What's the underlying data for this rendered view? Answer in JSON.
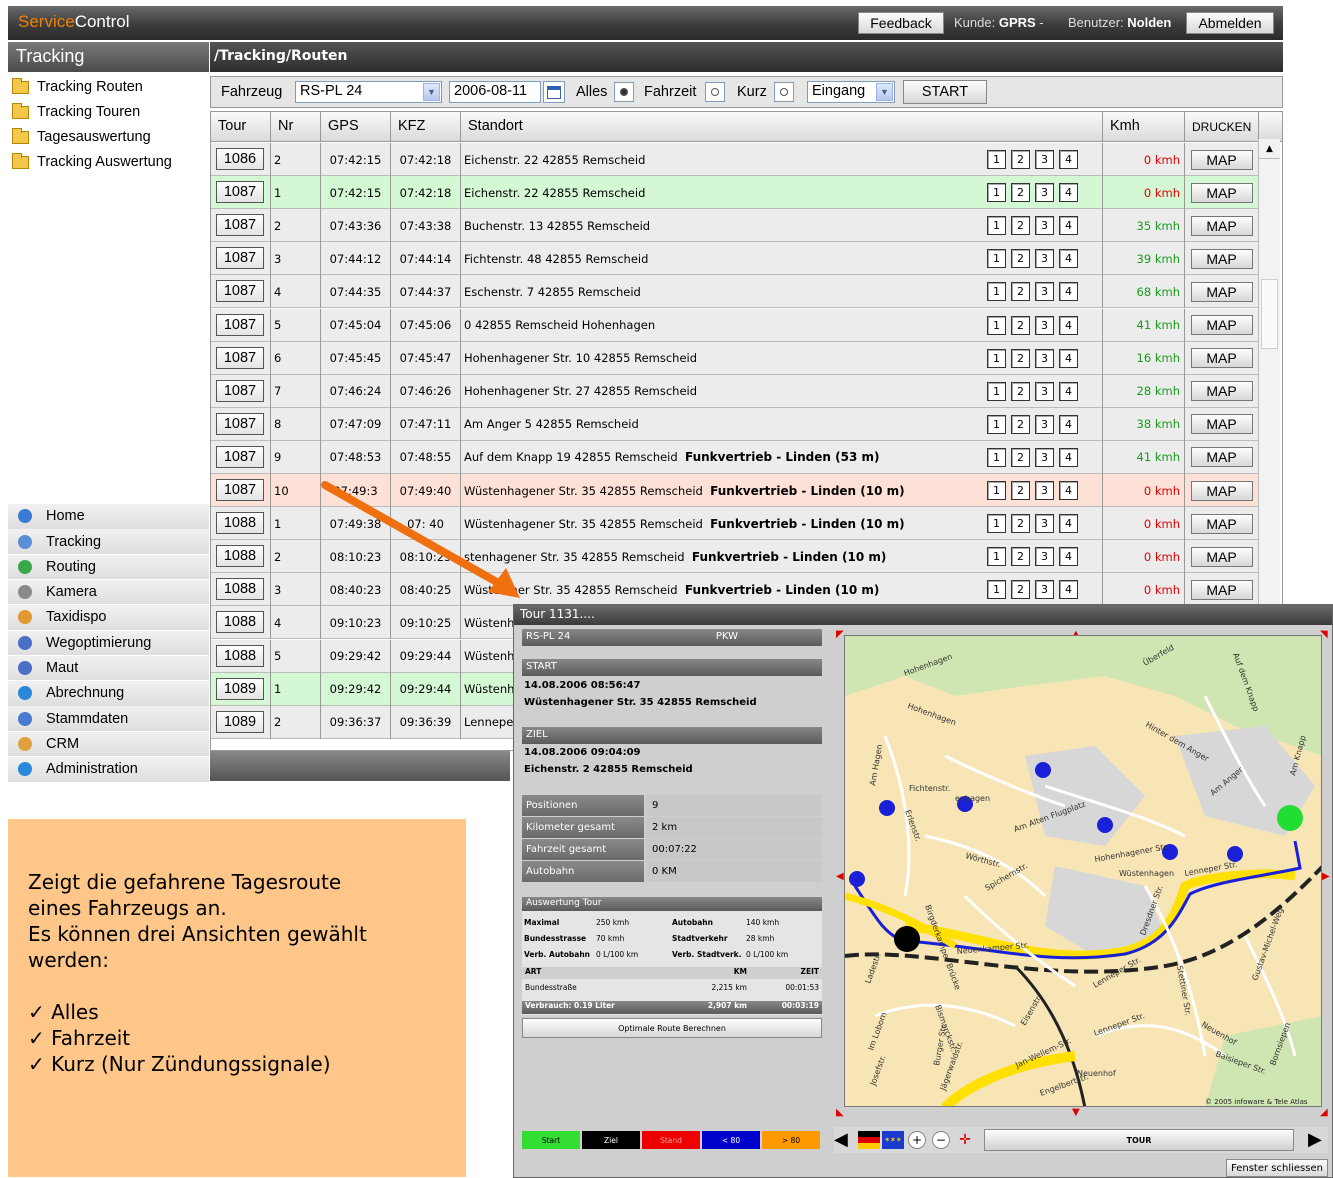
{
  "topbar": {
    "brand_prefix": "Service",
    "brand_suffix": "Control",
    "feedback_label": "Feedback",
    "customer_label": "Kunde:",
    "customer_value": "GPRS",
    "separator": "-",
    "user_label": "Benutzer:",
    "user_value": "Nolden",
    "logout_label": "Abmelden"
  },
  "sidebar": {
    "title": "Tracking",
    "tree": [
      "Tracking Routen",
      "Tracking Touren",
      "Tagesauswertung",
      "Tracking Auswertung"
    ],
    "nav": [
      {
        "label": "Home",
        "icon": "home-icon",
        "color": "#3a7bd5"
      },
      {
        "label": "Tracking",
        "icon": "tracking-icon",
        "color": "#5a8fd8"
      },
      {
        "label": "Routing",
        "icon": "routing-icon",
        "color": "#3aa84a"
      },
      {
        "label": "Kamera",
        "icon": "camera-icon",
        "color": "#8a8a8a"
      },
      {
        "label": "Taxidispo",
        "icon": "taxi-icon",
        "color": "#e09a30"
      },
      {
        "label": "Wegoptimierung",
        "icon": "optimize-icon",
        "color": "#4a6fc8"
      },
      {
        "label": "Maut",
        "icon": "toll-icon",
        "color": "#4a6fc8"
      },
      {
        "label": "Abrechnung",
        "icon": "billing-icon",
        "color": "#2a88d8"
      },
      {
        "label": "Stammdaten",
        "icon": "master-data-icon",
        "color": "#4a7ad0"
      },
      {
        "label": "CRM",
        "icon": "crm-icon",
        "color": "#e0a040"
      },
      {
        "label": "Administration",
        "icon": "admin-icon",
        "color": "#2a88d8"
      }
    ]
  },
  "main": {
    "breadcrumb": "/Tracking/Routen",
    "toolbar": {
      "vehicle_label": "Fahrzeug",
      "vehicle_value": "RS-PL 24",
      "date_value": "2006-08-11",
      "opt_all": "Alles",
      "opt_drive": "Fahrzeit",
      "opt_short": "Kurz",
      "direction_value": "Eingang",
      "start_label": "START"
    },
    "columns": [
      "Tour",
      "Nr",
      "GPS",
      "KFZ",
      "Standort",
      "Kmh",
      "DRUCKEN"
    ],
    "rows": [
      {
        "tour": "1086",
        "nr": "2",
        "gps": "07:42:15",
        "kfz": "07:42:18",
        "addr": "Eichenstr. 22 42855 Remscheid",
        "note": "",
        "kmh": "0 kmh",
        "bg": "#ececec",
        "kcolor": "#e00000"
      },
      {
        "tour": "1087",
        "nr": "1",
        "gps": "07:42:15",
        "kfz": "07:42:18",
        "addr": "Eichenstr. 22 42855 Remscheid",
        "note": "",
        "kmh": "0 kmh",
        "bg": "#d4f7d4",
        "kcolor": "#e00000"
      },
      {
        "tour": "1087",
        "nr": "2",
        "gps": "07:43:36",
        "kfz": "07:43:38",
        "addr": "Buchenstr. 13 42855 Remscheid",
        "note": "",
        "kmh": "35 kmh",
        "bg": "#ececec",
        "kcolor": "#1a9a1a"
      },
      {
        "tour": "1087",
        "nr": "3",
        "gps": "07:44:12",
        "kfz": "07:44:14",
        "addr": "Fichtenstr. 48 42855 Remscheid",
        "note": "",
        "kmh": "39 kmh",
        "bg": "#ececec",
        "kcolor": "#1a9a1a"
      },
      {
        "tour": "1087",
        "nr": "4",
        "gps": "07:44:35",
        "kfz": "07:44:37",
        "addr": "Eschenstr. 7 42855 Remscheid",
        "note": "",
        "kmh": "68 kmh",
        "bg": "#ececec",
        "kcolor": "#1a9a1a"
      },
      {
        "tour": "1087",
        "nr": "5",
        "gps": "07:45:04",
        "kfz": "07:45:06",
        "addr": "0 42855 Remscheid Hohenhagen",
        "note": "",
        "kmh": "41 kmh",
        "bg": "#ececec",
        "kcolor": "#1a9a1a"
      },
      {
        "tour": "1087",
        "nr": "6",
        "gps": "07:45:45",
        "kfz": "07:45:47",
        "addr": "Hohenhagener Str. 10 42855 Remscheid",
        "note": "",
        "kmh": "16 kmh",
        "bg": "#ececec",
        "kcolor": "#1a9a1a"
      },
      {
        "tour": "1087",
        "nr": "7",
        "gps": "07:46:24",
        "kfz": "07:46:26",
        "addr": "Hohenhagener Str. 27 42855 Remscheid",
        "note": "",
        "kmh": "28 kmh",
        "bg": "#ececec",
        "kcolor": "#1a9a1a"
      },
      {
        "tour": "1087",
        "nr": "8",
        "gps": "07:47:09",
        "kfz": "07:47:11",
        "addr": "Am Anger 5 42855 Remscheid",
        "note": "",
        "kmh": "38 kmh",
        "bg": "#ececec",
        "kcolor": "#1a9a1a"
      },
      {
        "tour": "1087",
        "nr": "9",
        "gps": "07:48:53",
        "kfz": "07:48:55",
        "addr": "Auf dem Knapp 19 42855 Remscheid",
        "note": "Funkvertrieb - Linden (53 m)",
        "kmh": "41 kmh",
        "bg": "#ececec",
        "kcolor": "#1a9a1a"
      },
      {
        "tour": "1087",
        "nr": "10",
        "gps": "07:49:3",
        "kfz": "07:49:40",
        "addr": "Wüstenhagener Str. 35 42855 Remscheid",
        "note": "Funkvertrieb - Linden (10 m)",
        "kmh": "0 kmh",
        "bg": "#fde0d6",
        "kcolor": "#e00000"
      },
      {
        "tour": "1088",
        "nr": "1",
        "gps": "07:49:38",
        "kfz": "07:  40",
        "addr": "Wüstenhagener Str. 35 42855 Remscheid",
        "note": "Funkvertrieb - Linden (10 m)",
        "kmh": "0 kmh",
        "bg": "#ececec",
        "kcolor": "#e00000"
      },
      {
        "tour": "1088",
        "nr": "2",
        "gps": "08:10:23",
        "kfz": "08:10:25",
        "addr": "stenhagener Str. 35 42855 Remscheid",
        "note": "Funkvertrieb - Linden (10 m)",
        "kmh": "0 kmh",
        "bg": "#ececec",
        "kcolor": "#e00000"
      },
      {
        "tour": "1088",
        "nr": "3",
        "gps": "08:40:23",
        "kfz": "08:40:25",
        "addr": "Wüste   ener Str. 35 42855 Remscheid",
        "note": "Funkvertrieb - Linden (10 m)",
        "kmh": "0 kmh",
        "bg": "#ececec",
        "kcolor": "#e00000"
      },
      {
        "tour": "1088",
        "nr": "4",
        "gps": "09:10:23",
        "kfz": "09:10:25",
        "addr": "Wüstenh",
        "note": "",
        "kmh": "",
        "bg": "#ececec",
        "kcolor": "#e00000"
      },
      {
        "tour": "1088",
        "nr": "5",
        "gps": "09:29:42",
        "kfz": "09:29:44",
        "addr": "Wüstenh",
        "note": "",
        "kmh": "",
        "bg": "#ececec",
        "kcolor": "#e00000"
      },
      {
        "tour": "1089",
        "nr": "1",
        "gps": "09:29:42",
        "kfz": "09:29:44",
        "addr": "Wüstenh",
        "note": "",
        "kmh": "",
        "bg": "#d4f7d4",
        "kcolor": "#e00000"
      },
      {
        "tour": "1089",
        "nr": "2",
        "gps": "09:36:37",
        "kfz": "09:36:39",
        "addr": "Lenneper",
        "note": "",
        "kmh": "",
        "bg": "#ececec",
        "kcolor": "#e00000"
      }
    ],
    "num_buttons": [
      "1",
      "2",
      "3",
      "4"
    ],
    "map_label": "MAP"
  },
  "info": {
    "line1": "Zeigt die gefahrene Tagesroute",
    "line2": "eines Fahrzeugs an.",
    "line3": "Es können drei Ansichten gewählt",
    "line4": "werden:",
    "bullets": [
      "Alles",
      "Fahrzeit",
      "Kurz (Nur Zündungssignale)"
    ]
  },
  "popup": {
    "title": "Tour 1131....",
    "vehicle": "RS-PL 24",
    "vehicle_type": "PKW",
    "start_label": "START",
    "start_time": "14.08.2006  08:56:47",
    "start_addr": "Wüstenhagener Str. 35 42855 Remscheid",
    "ziel_label": "ZIEL",
    "ziel_time": "14.08.2006  09:04:09",
    "ziel_addr": "Eichenstr. 2 42855 Remscheid",
    "stats": [
      {
        "k": "Positionen",
        "v": "9"
      },
      {
        "k": "Kilometer gesamt",
        "v": "2 km"
      },
      {
        "k": "Fahrzeit gesamt",
        "v": "00:07:22"
      },
      {
        "k": "Autobahn",
        "v": "0 KM"
      }
    ],
    "ausw_title": "Auswertung Tour",
    "ausw": [
      {
        "k1": "Maximal",
        "v1": "250 kmh",
        "k2": "Autobahn",
        "v2": "140 kmh"
      },
      {
        "k1": "Bundesstrasse",
        "v1": "70 kmh",
        "k2": "Stadtverkehr",
        "v2": "28 kmh"
      },
      {
        "k1": "Verb. Autobahn",
        "v1": "0 L/100 km",
        "k2": "Verb. Stadtverk.",
        "v2": "0 L/100 km"
      }
    ],
    "art_header": [
      "ART",
      "KM",
      "ZEIT"
    ],
    "art_row": [
      "Bundesstraße",
      "2,215 km",
      "00:01:53"
    ],
    "art_total": [
      "Verbrauch: 0.19 Liter",
      "2,907 km",
      "00:03:19"
    ],
    "optimal_label": "Optimale Route Berechnen",
    "legend": [
      {
        "label": "Start",
        "color": "#33dd33",
        "text": "#000"
      },
      {
        "label": "Ziel",
        "color": "#000000",
        "text": "#fff"
      },
      {
        "label": "Stand",
        "color": "#ee0000",
        "text": "#f5a0a0"
      },
      {
        "label": "< 80",
        "color": "#0000cc",
        "text": "#fff"
      },
      {
        "label": "> 80",
        "color": "#ff9900",
        "text": "#000"
      }
    ],
    "tour_label": "TOUR",
    "close_label": "Fenster schliessen",
    "copyright": "© 2005 infoware & Tele Atlas",
    "map_labels": [
      "Hohenhagen",
      "Überfeld",
      "Auf dem Knapp",
      "Hohenhagen",
      "Fichtenstr.",
      "enhagen",
      "Am Hagen",
      "Erlenstr.",
      "Am Alten Flugplatz",
      "Hinter dem Anger",
      "Am Anger",
      "Am Knapp",
      "Hohenhagener Str.",
      "Wüstenhagen",
      "Lenneper Str.",
      "Wörthstr.",
      "Spichernstr.",
      "Birgderkamper Brücke",
      "Neuenkamper Str.",
      "Lenneper Str.",
      "Dresdner Str.",
      "Stettiner Str.",
      "Gustav-Michel-Weg",
      "Ladestr.",
      "Bismarckstr.",
      "Im Loborn",
      "Eisenstr.",
      "Lenneper Str.",
      "Neuenhof",
      "Neuenhof",
      "Baisieper Str.",
      "Bornsiepen",
      "Burger Str.",
      "Jan-Wellem-Str.",
      "Josefstr.",
      "Engelbertstr.",
      "Jägerwaldstr."
    ]
  }
}
